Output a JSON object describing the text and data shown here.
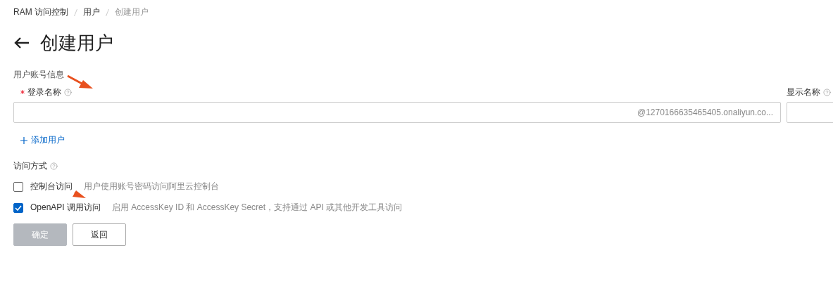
{
  "breadcrumb": [
    "RAM 访问控制",
    "用户",
    "创建用户"
  ],
  "title": "创建用户",
  "section": "用户账号信息",
  "login_name": {
    "label": "登录名称",
    "required": true,
    "suffix": "@1270166635465405.onaliyun.co..."
  },
  "display_name": {
    "label": "显示名称"
  },
  "add_user": "添加用户",
  "access": {
    "label": "访问方式",
    "options": [
      {
        "label": "控制台访问",
        "description": "用户使用账号密码访问阿里云控制台",
        "checked": false
      },
      {
        "label": "OpenAPI 调用访问",
        "description": "启用 AccessKey ID 和 AccessKey Secret，支持通过 API 或其他开发工具访问",
        "checked": true
      }
    ]
  },
  "buttons": [
    {
      "label": "确定",
      "disabled": true
    },
    {
      "label": "返回",
      "disabled": false
    }
  ]
}
